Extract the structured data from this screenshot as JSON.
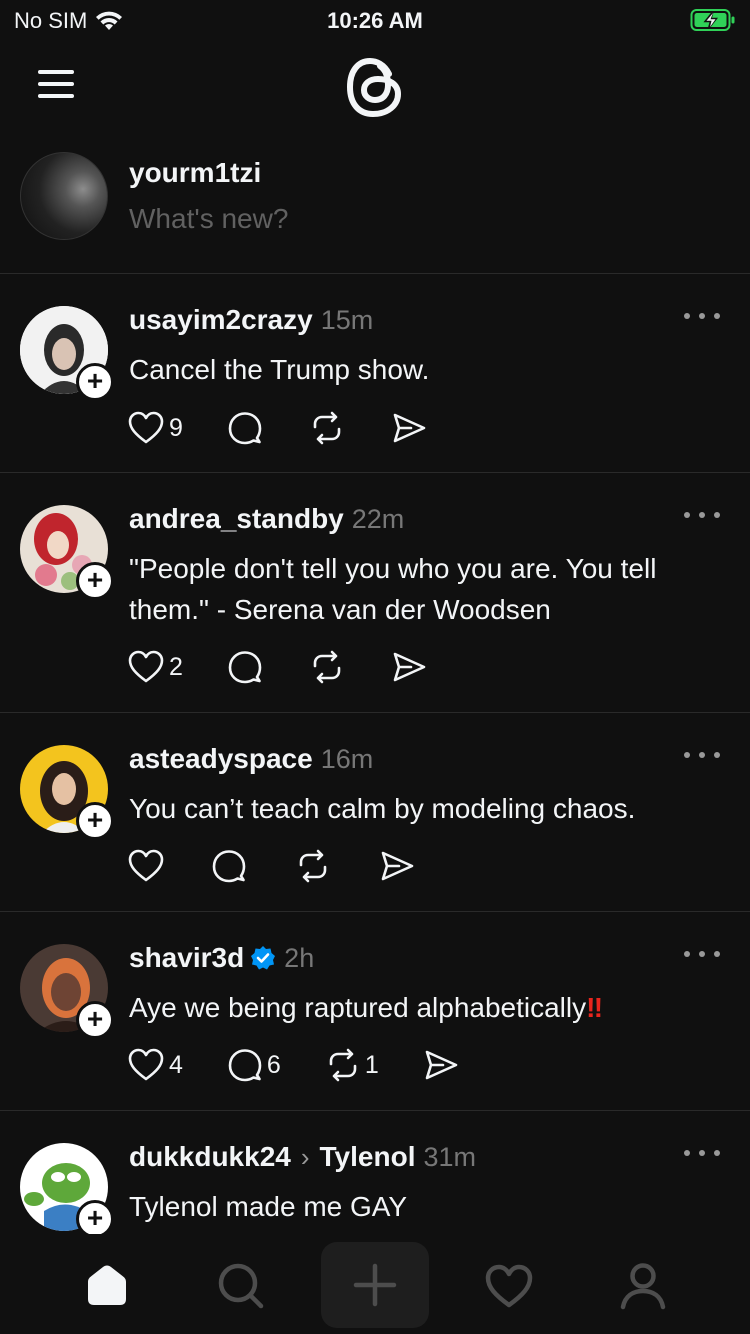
{
  "status_bar": {
    "carrier": "No SIM",
    "time": "10:26 AM",
    "wifi_icon": "wifi-icon",
    "battery_icon": "battery-charging-icon",
    "battery_color": "#30d158"
  },
  "top_nav": {
    "menu_icon": "hamburger-menu-icon",
    "logo": "threads-logo-icon"
  },
  "composer": {
    "username": "yourm1tzi",
    "placeholder": "What's new?"
  },
  "posts": [
    {
      "username": "usayim2crazy",
      "time": "15m",
      "text": "Cancel the Trump show.",
      "likes": "9",
      "replies": "",
      "reposts": "",
      "verified": false
    },
    {
      "username": "andrea_standby",
      "time": "22m",
      "text": "\"People don't tell you who you are. You tell them.\" - Serena van der Woodsen",
      "likes": "2",
      "replies": "",
      "reposts": "",
      "verified": false
    },
    {
      "username": "asteadyspace",
      "time": "16m",
      "text": "You can’t teach calm by modeling chaos.",
      "likes": "",
      "replies": "",
      "reposts": "",
      "verified": false
    },
    {
      "username": "shavir3d",
      "time": "2h",
      "text": "Aye we being raptured alphabetically",
      "text_suffix": "‼",
      "likes": "4",
      "replies": "6",
      "reposts": "1",
      "verified": true
    },
    {
      "username": "dukkdukk24",
      "community": "Tylenol",
      "time": "31m",
      "text": "Tylenol made me GAY",
      "likes": "",
      "replies": "",
      "reposts": "",
      "verified": false
    }
  ],
  "tab_bar": {
    "items": [
      {
        "name": "home",
        "icon": "home-icon",
        "active": true
      },
      {
        "name": "search",
        "icon": "search-icon",
        "active": false
      },
      {
        "name": "create",
        "icon": "plus-icon",
        "active": false
      },
      {
        "name": "activity",
        "icon": "heart-icon",
        "active": false
      },
      {
        "name": "profile",
        "icon": "person-icon",
        "active": false
      }
    ]
  },
  "colors": {
    "background": "#101010",
    "text": "#f3f5f7",
    "muted": "#777777",
    "divider": "#2a2a2a",
    "verified": "#0095f6",
    "bang": "#e8251d"
  }
}
